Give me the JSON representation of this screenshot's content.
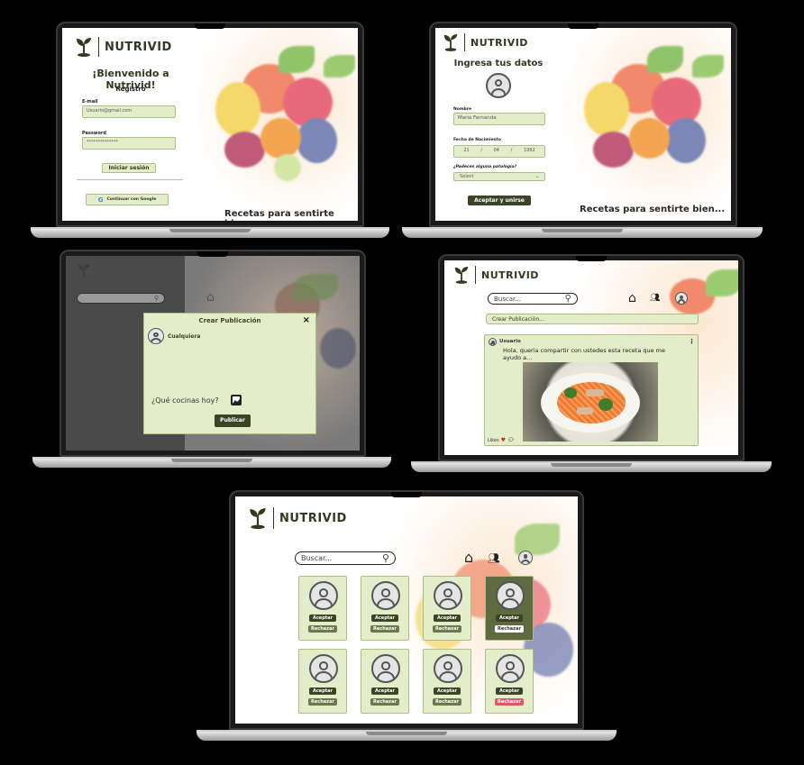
{
  "brand": "NUTRIVID",
  "tagline": "Recetas para sentirte bien...",
  "colors": {
    "accent_dark": "#3c4426",
    "accent_light": "#e4edc9",
    "reject_red": "#e0576a"
  },
  "login": {
    "welcome": "¡Bienvenido a Nutrivid!",
    "register": "Registro",
    "email_label": "E-mail",
    "email_value": "Usuario@gmail.com",
    "password_label": "Password",
    "password_value": "**************",
    "login_button": "Iniciar sesión",
    "google_button": "Continuar con Google"
  },
  "profile": {
    "title": "Ingresa tus datos",
    "name_label": "Nombre",
    "name_value": "Maria Fernanda",
    "birth_label": "Fecha de Nacimiento",
    "birth_day": "21",
    "birth_month": "04",
    "birth_year": "1992",
    "sep": "/",
    "pathology_label": "¿Padeces alguna patología?",
    "select_value": "Select",
    "accept_button": "Aceptar y unirse"
  },
  "create_post": {
    "title": "Crear Publicación",
    "user": "Cualquiera",
    "prompt": "¿Qué cocinas hoy?",
    "publish": "Publicar"
  },
  "feed": {
    "search_placeholder": "Buscar...",
    "create_button": "Crear Publicación...",
    "post_user": "Usuario",
    "post_text": "Hola, queria compartir con ustedes esta receta que me ayudo a...",
    "likes": "Likes"
  },
  "requests": {
    "search_placeholder": "Buscar...",
    "accept": "Aceptar",
    "reject": "Rechazar",
    "cards": [
      {
        "state": "normal"
      },
      {
        "state": "normal"
      },
      {
        "state": "normal"
      },
      {
        "state": "selected"
      },
      {
        "state": "normal"
      },
      {
        "state": "normal"
      },
      {
        "state": "normal"
      },
      {
        "state": "reject-red"
      }
    ]
  }
}
